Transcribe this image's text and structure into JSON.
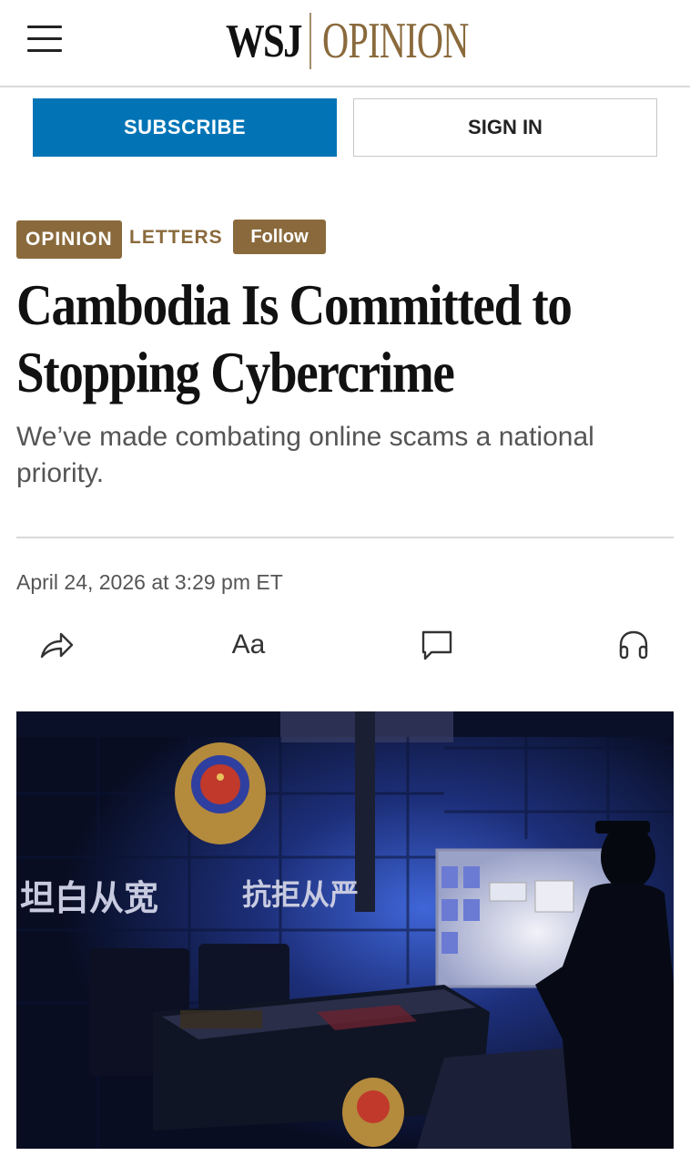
{
  "header": {
    "brand_wsj": "WSJ",
    "brand_section": "OPINION",
    "menu_icon": "hamburger-menu-icon"
  },
  "actions": {
    "subscribe": "SUBSCRIBE",
    "sign_in": "SIGN IN"
  },
  "article": {
    "section": "OPINION",
    "category": "LETTERS",
    "follow": "Follow",
    "headline": "Cambodia Is Committed to Stopping Cybercrime",
    "dek": "We’ve made combating online scams a national priority.",
    "date": "April 24, 2026 at 3:29 pm ET"
  },
  "toolbar": {
    "share_icon": "share-icon",
    "text_size_label": "Aa",
    "comment_icon": "comment-icon",
    "audio_icon": "headphones-icon"
  },
  "photo": {
    "wall_text_left": "坦白从宽",
    "wall_text_right": "抗拒从严"
  },
  "colors": {
    "accent_brown": "#8a6a3c",
    "subscribe_blue": "#0274b6"
  }
}
